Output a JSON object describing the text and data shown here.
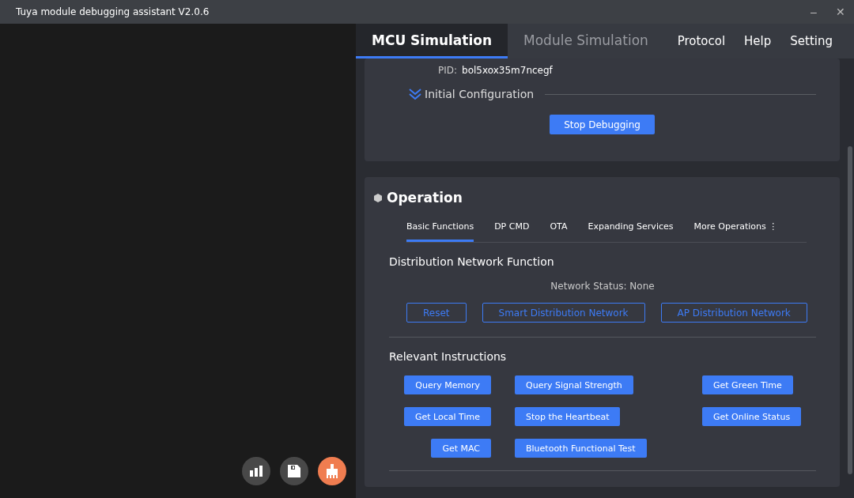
{
  "window": {
    "title": "Tuya module debugging assistant V2.0.6",
    "controls": [
      "–",
      "✕"
    ]
  },
  "main_tabs": [
    {
      "label": "MCU Simulation",
      "selected": true
    },
    {
      "label": "Module Simulation",
      "selected": false
    }
  ],
  "menu": [
    "Protocol",
    "Help",
    "Setting"
  ],
  "config": {
    "pid_label": "PID:",
    "pid": "bol5xox35m7ncegf",
    "section": "Initial Configuration",
    "expanded": false,
    "button": "Stop Debugging"
  },
  "operation": {
    "title": "Operation",
    "tabs": [
      {
        "label": "Basic Functions",
        "selected": true
      },
      {
        "label": "DP CMD",
        "selected": false
      },
      {
        "label": "OTA",
        "selected": false
      },
      {
        "label": "Expanding Services",
        "selected": false
      },
      {
        "label": "More Operations",
        "selected": false,
        "more": "⋮"
      }
    ],
    "network": {
      "heading": "Distribution Network Function",
      "status": "Network Status: None",
      "buttons": [
        "Reset",
        "Smart Distribution Network",
        "AP Distribution Network"
      ]
    },
    "instructions": {
      "heading": "Relevant Instructions",
      "buttons": [
        "Query Memory",
        "Query Signal Strength",
        "Get Green Time",
        "Get Local Time",
        "Stop the Heartbeat",
        "Get Online Status",
        "Get MAC",
        "Bluetooth Functional Test"
      ]
    }
  },
  "actions": [
    {
      "kind": "chart",
      "color": "#484848"
    },
    {
      "kind": "save",
      "color": "#484848"
    },
    {
      "kind": "clean",
      "color": "#f07d50"
    }
  ]
}
